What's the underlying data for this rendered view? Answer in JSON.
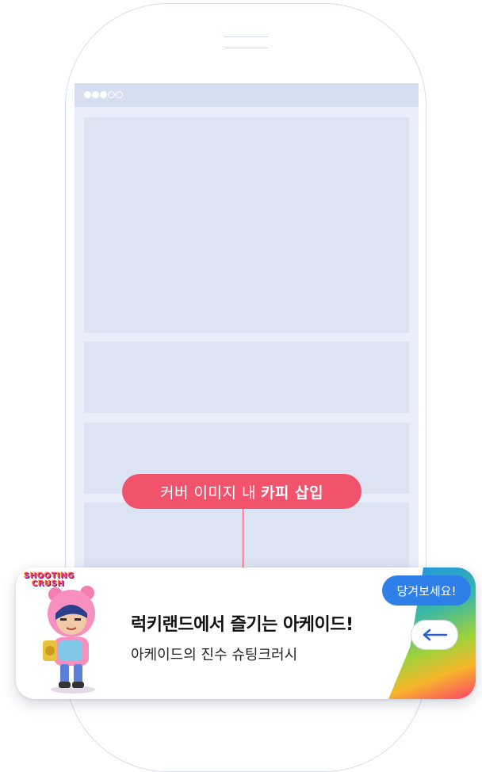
{
  "status": {
    "dots": [
      "filled",
      "filled",
      "filled",
      "empty",
      "empty"
    ]
  },
  "annotation": {
    "label_light": "커버 이미지 내",
    "label_bold": "카피 삽입"
  },
  "banner": {
    "logo_line1": "SHOOTING",
    "logo_line2": "CRUSH",
    "title": "럭키랜드에서 즐기는 아케이드!",
    "subtitle": "아케이드의 진수 슈팅크러시",
    "pull_label": "당겨보세요!",
    "arrow_icon": "left-arrow-icon"
  },
  "colors": {
    "accent_pink": "#f2536c",
    "accent_blue": "#2f7fe8",
    "placeholder": "#dce4f3"
  }
}
